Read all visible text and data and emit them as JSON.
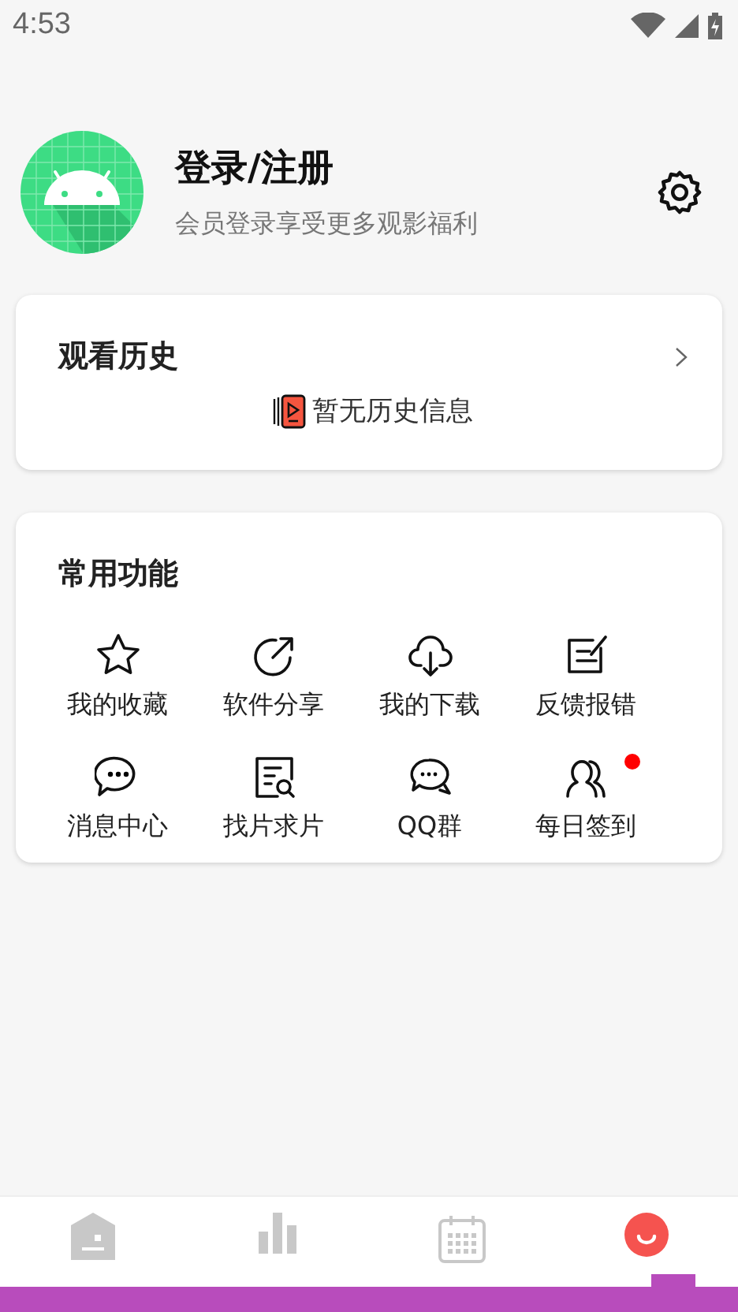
{
  "status_bar": {
    "time": "4:53"
  },
  "profile": {
    "title": "登录/注册",
    "subtitle": "会员登录享受更多观影福利"
  },
  "history": {
    "title": "观看历史",
    "empty_text": "暂无历史信息"
  },
  "functions": {
    "title": "常用功能",
    "items": [
      {
        "label": "我的收藏",
        "badge": false
      },
      {
        "label": "软件分享",
        "badge": false
      },
      {
        "label": "我的下载",
        "badge": false
      },
      {
        "label": "反馈报错",
        "badge": false
      },
      {
        "label": "消息中心",
        "badge": false
      },
      {
        "label": "找片求片",
        "badge": false
      },
      {
        "label": "QQ群",
        "badge": false
      },
      {
        "label": "每日签到",
        "badge": true
      }
    ]
  },
  "nav": [
    {
      "selected": false
    },
    {
      "selected": false
    },
    {
      "selected": false
    },
    {
      "selected": true
    }
  ]
}
